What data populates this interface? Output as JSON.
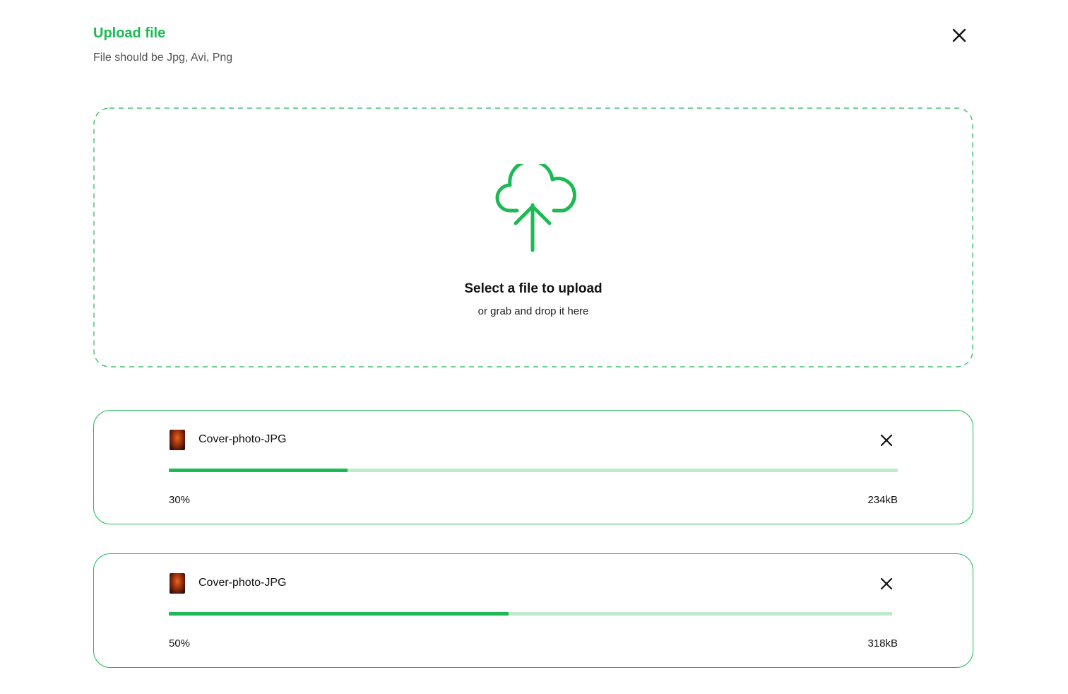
{
  "header": {
    "title": "Upload file",
    "subtitle": "File should be Jpg, Avi, Png",
    "close_icon": "close-icon"
  },
  "dropzone": {
    "icon": "cloud-upload-icon",
    "title": "Select a file to upload",
    "subtitle": "or grab and drop it here"
  },
  "files": [
    {
      "name": "Cover-photo-JPG",
      "progress_label": "30%",
      "progress_fraction": 0.245,
      "size": "234kB",
      "thumbnail": "image-thumbnail",
      "remove_icon": "close-icon"
    },
    {
      "name": "Cover-photo-JPG",
      "progress_label": "50%",
      "progress_fraction": 0.47,
      "size": "318kB",
      "thumbnail": "image-thumbnail",
      "remove_icon": "close-icon"
    }
  ],
  "colors": {
    "accent": "#1db954",
    "accent_light": "#bfe9cd",
    "text": "#111111",
    "muted": "#555555"
  }
}
